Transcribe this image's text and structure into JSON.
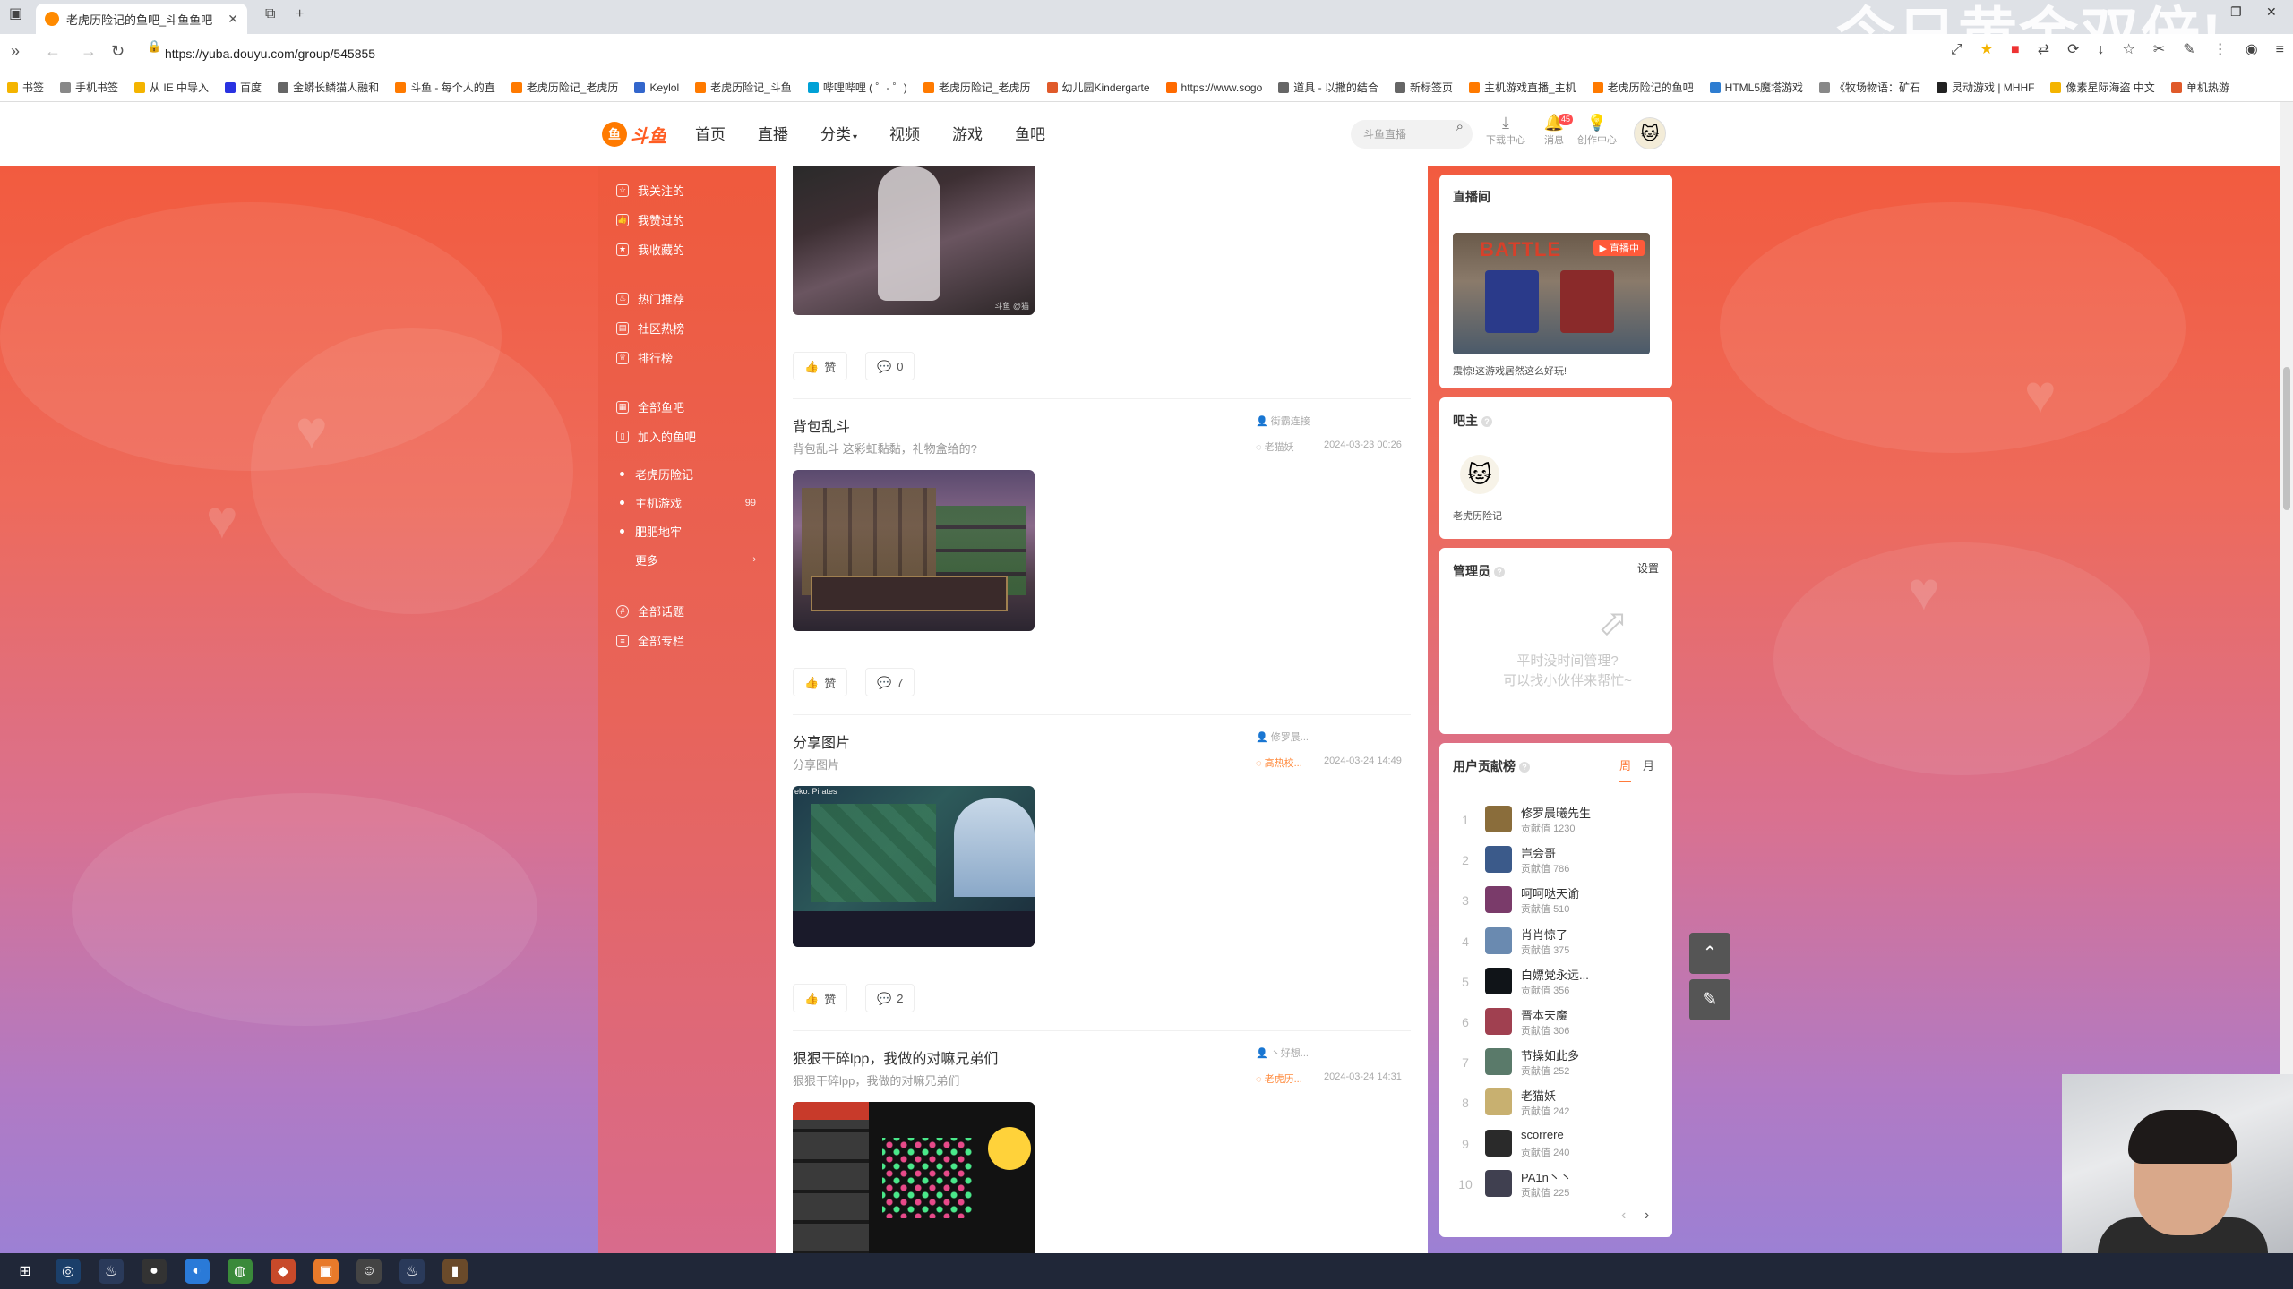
{
  "browser": {
    "tab_title": "老虎历险记的鱼吧_斗鱼鱼吧",
    "url": "https://yuba.douyu.com/group/545855",
    "watermark_text": "今日黄金双倍!",
    "bookmarks": [
      {
        "label": "书签",
        "color": "#f4b400"
      },
      {
        "label": "手机书签",
        "color": "#888888"
      },
      {
        "label": "从 IE 中导入",
        "color": "#f4b400"
      },
      {
        "label": "百度",
        "color": "#2932e1"
      },
      {
        "label": "金蟒长鳞猫人融和",
        "color": "#666666"
      },
      {
        "label": "斗鱼 - 每个人的直",
        "color": "#ff7a00"
      },
      {
        "label": "老虎历险记_老虎历",
        "color": "#ff7a00"
      },
      {
        "label": "Keylol",
        "color": "#3366cc"
      },
      {
        "label": "老虎历险记_斗鱼",
        "color": "#ff7a00"
      },
      {
        "label": "哔哩哔哩 ( ゜- ゜)",
        "color": "#00a1d6"
      },
      {
        "label": "老虎历险记_老虎历",
        "color": "#ff7a00"
      },
      {
        "label": "幼儿园Kindergarte",
        "color": "#e05a2a"
      },
      {
        "label": "https://www.sogo",
        "color": "#ff6a00"
      },
      {
        "label": "道具 - 以撒的结合",
        "color": "#666666"
      },
      {
        "label": "新标签页",
        "color": "#666666"
      },
      {
        "label": "主机游戏直播_主机",
        "color": "#ff7a00"
      },
      {
        "label": "老虎历险记的鱼吧",
        "color": "#ff7a00"
      },
      {
        "label": "HTML5魔塔游戏",
        "color": "#2e7dd1"
      },
      {
        "label": "《牧场物语：矿石",
        "color": "#888888"
      },
      {
        "label": "灵动游戏 | MHHF",
        "color": "#222222"
      },
      {
        "label": "像素星际海盗 中文",
        "color": "#f4b400"
      },
      {
        "label": "单机热游",
        "color": "#e05a2a"
      }
    ]
  },
  "header": {
    "logo_text": "斗鱼",
    "nav": [
      "首页",
      "直播",
      "分类",
      "视频",
      "游戏",
      "鱼吧"
    ],
    "search_placeholder": "斗鱼直播",
    "icons": [
      {
        "label": "下载中心",
        "icon": "download-icon"
      },
      {
        "label": "消息",
        "icon": "bell-icon"
      },
      {
        "label": "创作中心",
        "icon": "bulb-icon"
      }
    ],
    "message_badge": "45"
  },
  "sidebar": {
    "group1": [
      "我关注的",
      "我赞过的",
      "我收藏的"
    ],
    "group2": [
      "热门推荐",
      "社区热榜",
      "排行榜"
    ],
    "group3": [
      "全部鱼吧",
      "加入的鱼吧"
    ],
    "joined": [
      {
        "label": "老虎历险记",
        "count": ""
      },
      {
        "label": "主机游戏",
        "count": "99"
      },
      {
        "label": "肥肥地牢",
        "count": ""
      }
    ],
    "more_label": "更多",
    "group4": [
      "全部话题",
      "全部专栏"
    ]
  },
  "feed": {
    "like_label": "赞",
    "posts": [
      {
        "title": "",
        "desc": "",
        "author": "",
        "time": "",
        "comments": "0",
        "watermark": "斗鱼 @猫"
      },
      {
        "title": "背包乱斗",
        "desc": "背包乱斗 这彩虹黏黏，礼物盒给的?",
        "author": "街霸连接",
        "tag": "老猫妖",
        "time": "2024-03-23 00:26",
        "comments": "7"
      },
      {
        "title": "分享图片",
        "desc": "分享图片",
        "author": "修罗晨...",
        "tag": "高热校...",
        "time": "2024-03-24 14:49",
        "comments": "2",
        "img_caption": "eko: Pirates"
      },
      {
        "title": "狠狠干碎lpp，我做的对嘛兄弟们",
        "desc": "狠狠干碎lpp，我做的对嘛兄弟们",
        "author": "丶好想...",
        "tag": "老虎历...",
        "time": "2024-03-24 14:31"
      }
    ]
  },
  "right": {
    "live_title": "直播间",
    "live_badge": "直播中",
    "live_game_text": "BATTLE",
    "live_caption": "震惊!这游戏居然这么好玩!",
    "owner_title": "吧主",
    "owner_name": "老虎历险记",
    "admin_title": "管理员",
    "admin_setting": "设置",
    "admin_empty_line1": "平时没时间管理?",
    "admin_empty_line2": "可以找小伙伴来帮忙~",
    "rank_title": "用户贡献榜",
    "rank_tab_week": "周",
    "rank_tab_month": "月",
    "rank_value_prefix": "贡献值",
    "ranks": [
      {
        "n": "1",
        "name": "修罗晨曦先生",
        "val": "1230",
        "color": "#8a6d3b"
      },
      {
        "n": "2",
        "name": "岂会哥",
        "val": "786",
        "color": "#3b5a8a"
      },
      {
        "n": "3",
        "name": "呵呵哒天谕",
        "val": "510",
        "color": "#7a3b6a"
      },
      {
        "n": "4",
        "name": "肖肖惊了",
        "val": "375",
        "color": "#6a8ab0"
      },
      {
        "n": "5",
        "name": "白嫖党永远...",
        "val": "356",
        "color": "#101418"
      },
      {
        "n": "6",
        "name": "晋本天魔",
        "val": "306",
        "color": "#a04050"
      },
      {
        "n": "7",
        "name": "节操如此多",
        "val": "252",
        "color": "#5a7a6a"
      },
      {
        "n": "8",
        "name": "老猫妖",
        "val": "242",
        "color": "#c8b070"
      },
      {
        "n": "9",
        "name": "scorrere",
        "val": "240",
        "color": "#2a2a2a"
      },
      {
        "n": "10",
        "name": "PA1n丶丶",
        "val": "225",
        "color": "#404050"
      }
    ]
  }
}
